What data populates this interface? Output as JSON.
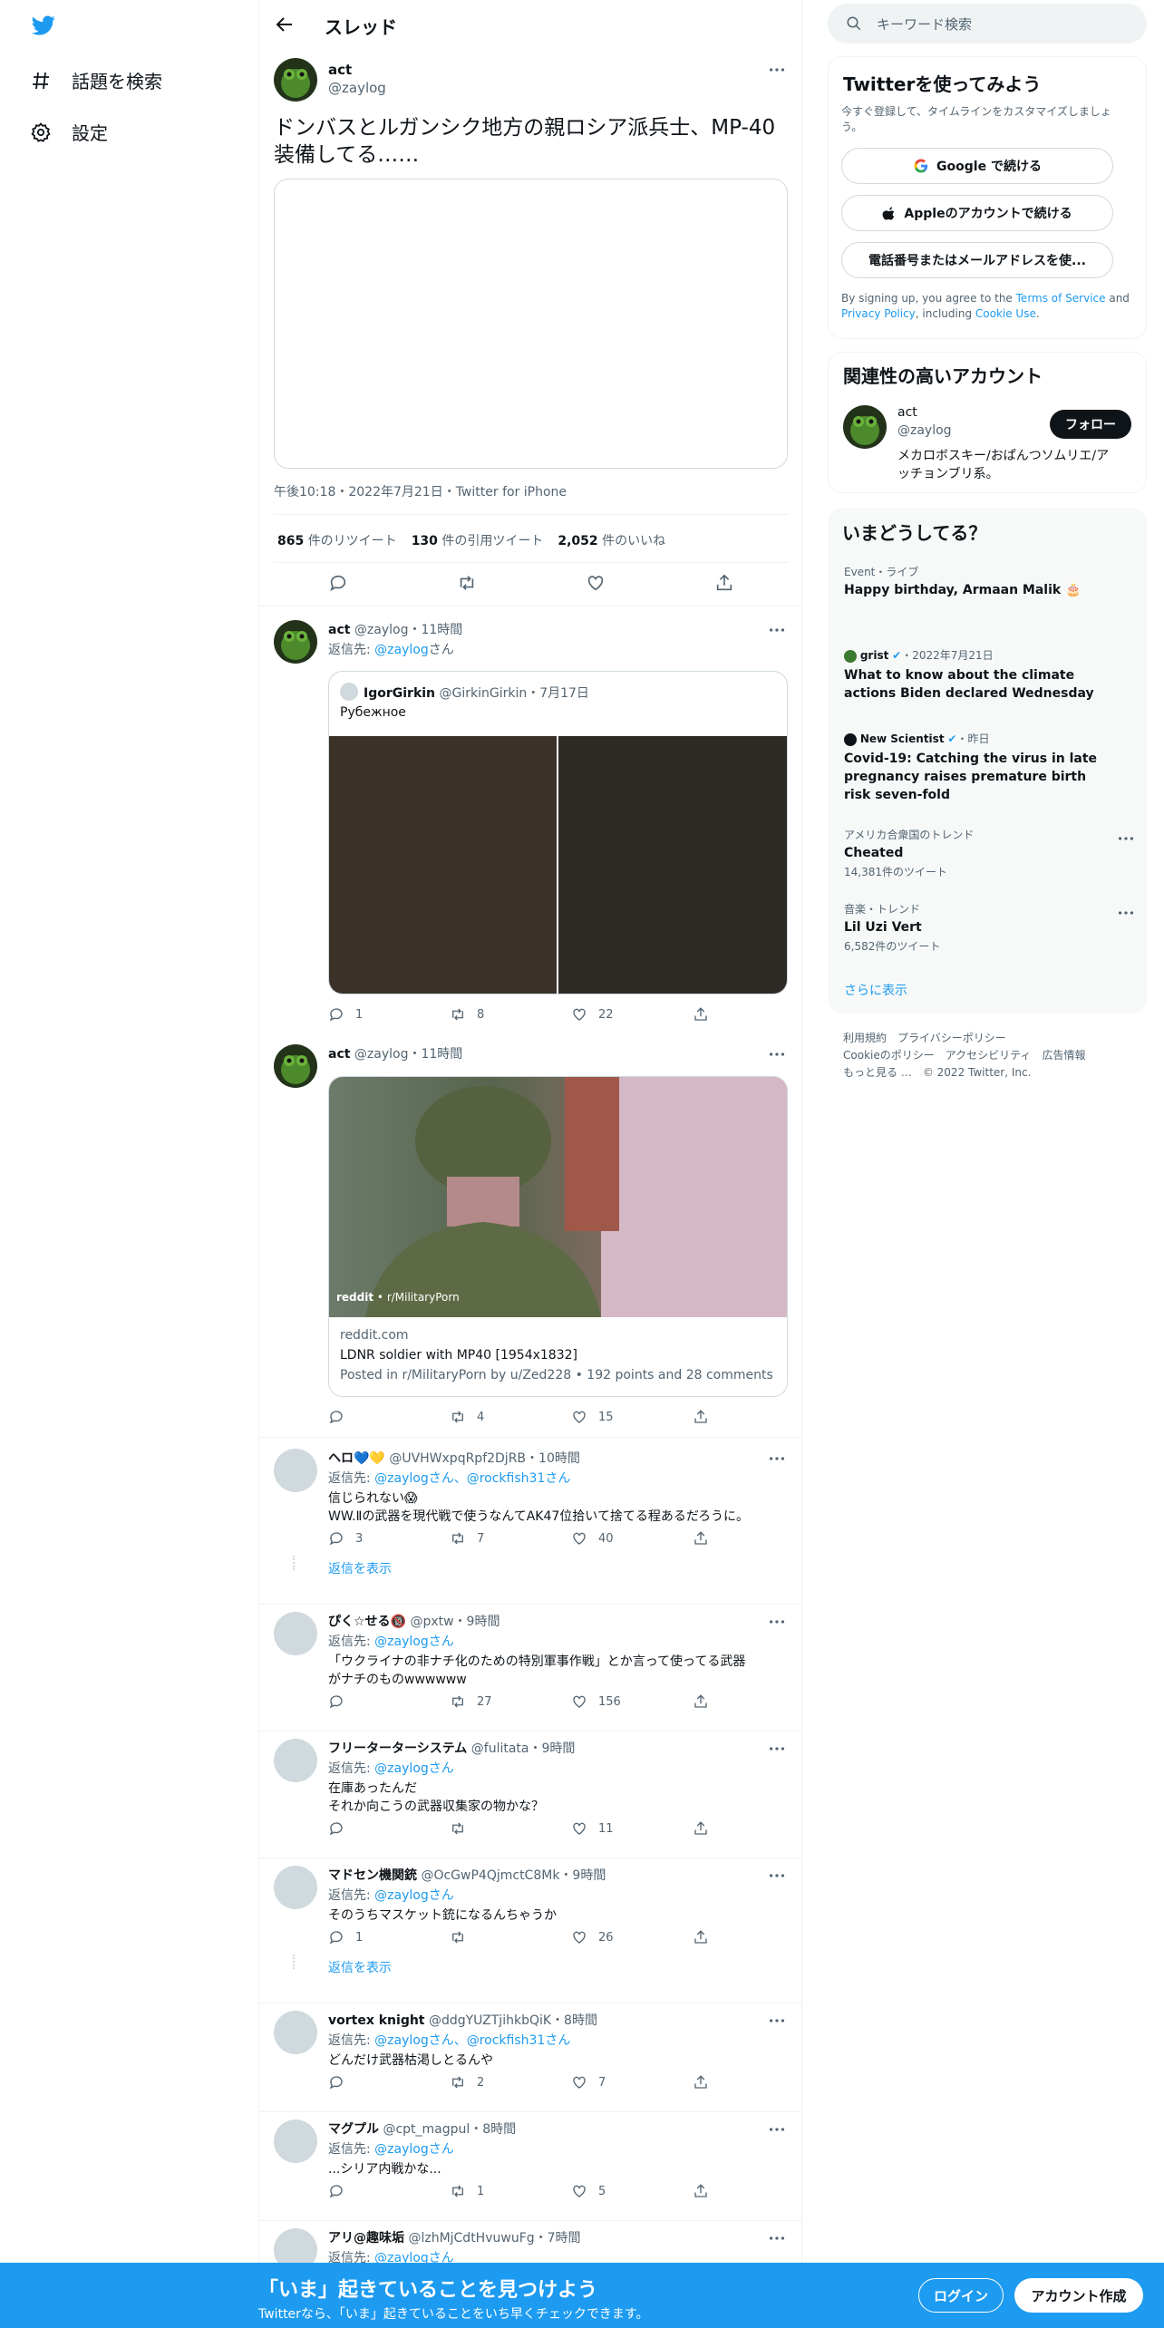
{
  "sidebar": {
    "explore": "話題を検索",
    "settings": "設定"
  },
  "header": {
    "title": "スレッド"
  },
  "main_tweet": {
    "name": "act",
    "handle": "@zaylog",
    "text": "ドンバスとルガンシク地方の親ロシア派兵士、MP-40装備してる……",
    "time": "午後10:18・2022年7月21日・Twitter for iPhone",
    "retweets_n": "865",
    "retweets_label": "件のリツイート",
    "quotes_n": "130",
    "quotes_label": "件の引用ツイート",
    "likes_n": "2,052",
    "likes_label": "件のいいね"
  },
  "reply1": {
    "name": "act",
    "meta": "@zaylog・11時間",
    "replying": "返信先: ",
    "replying_to": "@zaylog",
    "san": "さん",
    "quote": {
      "name": "IgorGirkin",
      "meta": "@GirkinGirkin・7月17日",
      "text": "Рубежное"
    },
    "replies": "1",
    "retweets": "8",
    "likes": "22"
  },
  "reply2": {
    "name": "act",
    "meta": "@zaylog・11時間",
    "link": {
      "brand": "reddit",
      "sub": "r/MilitaryPorn",
      "domain": "reddit.com",
      "title": "LDNR soldier with MP40 [1954x1832]",
      "desc": "Posted in r/MilitaryPorn by u/Zed228 • 192 points and 28 comments"
    },
    "replies": "",
    "retweets": "4",
    "likes": "15"
  },
  "replies": [
    {
      "name": "ヘロ💙💛",
      "meta": "@UVHWxpqRpf2DjRB・10時間",
      "to": "@zaylogさん、@rockfish31さん",
      "l1": "信じられない😱",
      "l2": "WW.Ⅱの武器を現代戦で使うなんてAK47位拾いて捨てる程あるだろうに。",
      "r": "3",
      "rt": "7",
      "lk": "40",
      "show": "返信を表示"
    },
    {
      "name": "ぴく☆せる🔞",
      "meta": "@pxtw・9時間",
      "to": "@zaylogさん",
      "l1": "「ウクライナの非ナチ化のための特別軍事作戦」とか言って使ってる武器",
      "l2": "がナチのものwwwwww",
      "r": "",
      "rt": "27",
      "lk": "156",
      "show": ""
    },
    {
      "name": "フリーターターシステム",
      "meta": "@fulitata・9時間",
      "to": "@zaylogさん",
      "l1": "在庫あったんだ",
      "l2": "それか向こうの武器収集家の物かな？",
      "r": "",
      "rt": "",
      "lk": "11",
      "show": ""
    },
    {
      "name": "マドセン機関銃",
      "meta": "@OcGwP4QjmctC8Mk・9時間",
      "to": "@zaylogさん",
      "l1": "そのうちマスケット銃になるんちゃうか",
      "l2": "",
      "r": "1",
      "rt": "",
      "lk": "26",
      "show": "返信を表示"
    },
    {
      "name": "vortex knight",
      "meta": "@ddgYUZTjihkbQiK・8時間",
      "to": "@zaylogさん、@rockfish31さん",
      "l1": "どんだけ武器枯渇しとるんや",
      "l2": "",
      "r": "",
      "rt": "2",
      "lk": "7",
      "show": ""
    },
    {
      "name": "マグプル",
      "meta": "@cpt_magpul・8時間",
      "to": "@zaylogさん",
      "l1": "...シリア内戦かな...",
      "l2": "",
      "r": "",
      "rt": "1",
      "lk": "5",
      "show": ""
    },
    {
      "name": "アリ@趣味垢",
      "meta": "@lzhMjCdtHvuwuFg・7時間",
      "to": "@zaylogさん",
      "l1": "",
      "l2": "",
      "r": "",
      "rt": "",
      "lk": "",
      "show": ""
    }
  ],
  "right": {
    "search_placeholder": "キーワード検索",
    "signup": {
      "title": "Twitterを使ってみよう",
      "sub": "今すぐ登録して、タイムラインをカスタマイズしましょう。",
      "google": "Google で続ける",
      "apple": "Appleのアカウントで続ける",
      "phone": "電話番号またはメールアドレスを使...",
      "terms_a": "By signing up, you agree to the ",
      "tos": "Terms of Service",
      "and": " and",
      "privacy": "Privacy Policy",
      "including": ", including ",
      "cookie": "Cookie Use",
      "dot": "."
    },
    "related": {
      "title": "関連性の高いアカウント",
      "name": "act",
      "handle": "@zaylog",
      "follow": "フォロー",
      "bio1": "メカロボスキー/おぱんつソムリエ/ア",
      "bio2": "ッチョンブリ系。"
    },
    "trends": {
      "title": "いまどうしてる？",
      "t1_meta": "Event・ライブ",
      "t1": "Happy birthday, Armaan Malik 🎂",
      "t2_src": "grist",
      "t2_meta": "・2022年7月21日",
      "t2_l1": "What to know about the climate",
      "t2_l2": "actions Biden declared Wednesday",
      "t3_src": "New Scientist",
      "t3_meta": "・昨日",
      "t3_l1": "Covid-19: Catching the virus in late",
      "t3_l2": "pregnancy raises premature birth",
      "t3_l3": "risk seven-fold",
      "t4_meta": "アメリカ合衆国のトレンド",
      "t4": "Cheated",
      "t4_count": "14,381件のツイート",
      "t5_meta": "音楽・トレンド",
      "t5": "Lil Uzi Vert",
      "t5_count": "6,582件のツイート",
      "more": "さらに表示"
    },
    "footer": {
      "f1": "利用規約",
      "f2": "プライバシーポリシー",
      "f3": "Cookieのポリシー",
      "f4": "アクセシビリティ",
      "f5": "広告情報",
      "f6": "もっと見る …",
      "f7": "© 2022 Twitter, Inc."
    }
  },
  "bottom": {
    "title": "「いま」起きていることを見つけよう",
    "sub": "Twitterなら、「いま」起きていることをいち早くチェックできます。",
    "login": "ログイン",
    "signup": "アカウント作成"
  },
  "colors": {
    "accent": "#1d9bf0",
    "text": "#0f1419",
    "muted": "#536471"
  }
}
